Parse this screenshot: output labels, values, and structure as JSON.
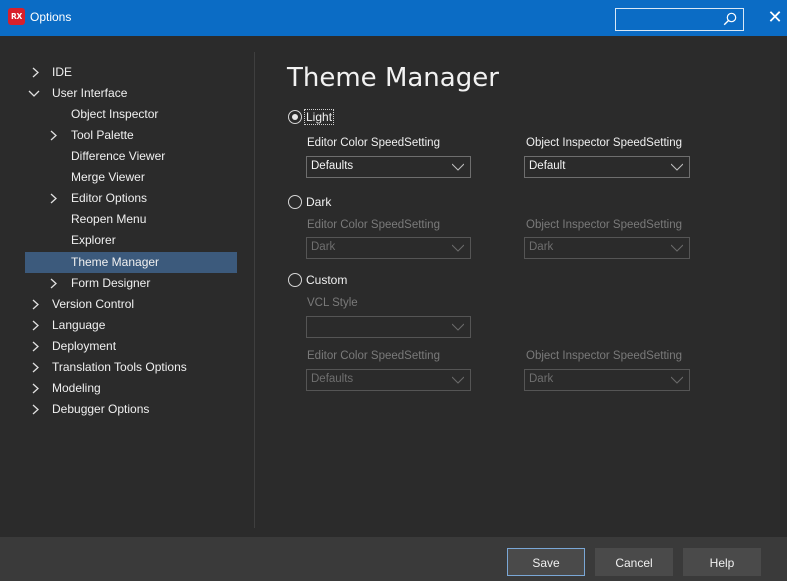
{
  "window": {
    "app_icon_text": "RX",
    "title": "Options",
    "search_placeholder": "",
    "close_glyph": "✕"
  },
  "tree": {
    "items": [
      {
        "label": "IDE",
        "expandable": true,
        "expanded": false,
        "level": 0
      },
      {
        "label": "User Interface",
        "expandable": true,
        "expanded": true,
        "level": 0
      },
      {
        "label": "Object Inspector",
        "expandable": false,
        "level": 1
      },
      {
        "label": "Tool Palette",
        "expandable": true,
        "expanded": false,
        "level": 1
      },
      {
        "label": "Difference Viewer",
        "expandable": false,
        "level": 1
      },
      {
        "label": "Merge Viewer",
        "expandable": false,
        "level": 1
      },
      {
        "label": "Editor Options",
        "expandable": true,
        "expanded": false,
        "level": 1
      },
      {
        "label": "Reopen Menu",
        "expandable": false,
        "level": 1
      },
      {
        "label": "Explorer",
        "expandable": false,
        "level": 1
      },
      {
        "label": "Theme Manager",
        "expandable": false,
        "level": 1,
        "selected": true
      },
      {
        "label": "Form Designer",
        "expandable": true,
        "expanded": false,
        "level": 1
      },
      {
        "label": "Version Control",
        "expandable": true,
        "expanded": false,
        "level": 0
      },
      {
        "label": "Language",
        "expandable": true,
        "expanded": false,
        "level": 0
      },
      {
        "label": "Deployment",
        "expandable": true,
        "expanded": false,
        "level": 0
      },
      {
        "label": "Translation Tools Options",
        "expandable": true,
        "expanded": false,
        "level": 0
      },
      {
        "label": "Modeling",
        "expandable": true,
        "expanded": false,
        "level": 0
      },
      {
        "label": "Debugger Options",
        "expandable": true,
        "expanded": false,
        "level": 0
      }
    ]
  },
  "main": {
    "title": "Theme Manager",
    "light": {
      "label": "Light",
      "checked": true,
      "editor_label": "Editor Color SpeedSetting",
      "editor_value": "Defaults",
      "inspector_label": "Object Inspector SpeedSetting",
      "inspector_value": "Default"
    },
    "dark": {
      "label": "Dark",
      "checked": false,
      "editor_label": "Editor Color SpeedSetting",
      "editor_value": "Dark",
      "inspector_label": "Object Inspector SpeedSetting",
      "inspector_value": "Dark"
    },
    "custom": {
      "label": "Custom",
      "checked": false,
      "vcl_label": "VCL Style",
      "vcl_value": "",
      "editor_label": "Editor Color SpeedSetting",
      "editor_value": "Defaults",
      "inspector_label": "Object Inspector SpeedSetting",
      "inspector_value": "Dark"
    }
  },
  "footer": {
    "save_label": "Save",
    "cancel_label": "Cancel",
    "help_label": "Help"
  },
  "colors": {
    "titlebar": "#0b6cc5",
    "background": "#2b2b2b",
    "selection": "#3c5a7c",
    "footer": "#3a3a3a",
    "icon_badge": "#d8202c"
  }
}
